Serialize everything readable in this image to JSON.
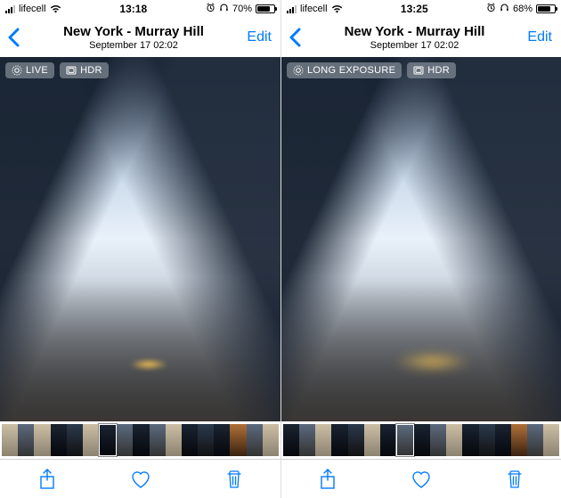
{
  "left": {
    "status": {
      "carrier": "lifecell",
      "time": "13:18",
      "battery_pct": "70%",
      "battery_fill": 70
    },
    "nav": {
      "title": "New York - Murray Hill",
      "subtitle": "September 17  02:02",
      "edit": "Edit"
    },
    "badges": {
      "primary": "LIVE",
      "secondary": "HDR"
    }
  },
  "right": {
    "status": {
      "carrier": "lifecell",
      "time": "13:25",
      "battery_pct": "68%",
      "battery_fill": 68
    },
    "nav": {
      "title": "New York - Murray Hill",
      "subtitle": "September 17  02:02",
      "edit": "Edit"
    },
    "badges": {
      "primary": "LONG EXPOSURE",
      "secondary": "HDR"
    }
  }
}
